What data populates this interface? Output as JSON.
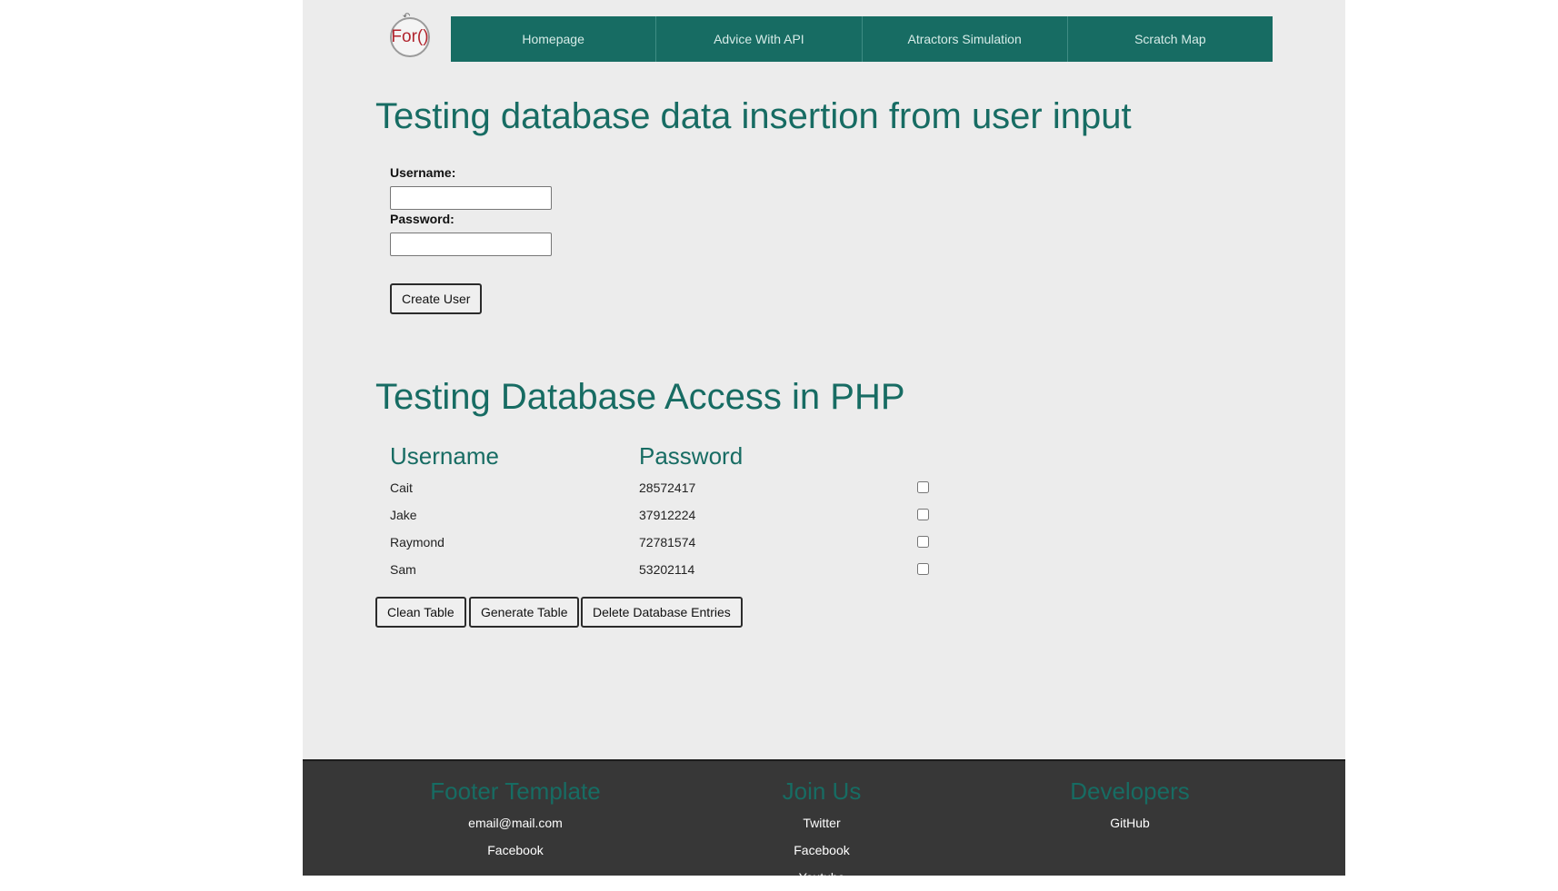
{
  "header": {
    "logo_text": "For()",
    "nav": [
      {
        "label": "Homepage"
      },
      {
        "label": "Advice With API"
      },
      {
        "label": "Atractors Simulation"
      },
      {
        "label": "Scratch Map"
      }
    ]
  },
  "insert_section": {
    "title": "Testing database data insertion from user input",
    "username_label": "Username:",
    "username_value": "",
    "password_label": "Password:",
    "password_value": "",
    "create_button": "Create User"
  },
  "access_section": {
    "title": "Testing Database Access in PHP",
    "columns": [
      "Username",
      "Password"
    ],
    "rows": [
      {
        "username": "Cait",
        "password": "28572417",
        "checked": false
      },
      {
        "username": "Jake",
        "password": "37912224",
        "checked": false
      },
      {
        "username": "Raymond",
        "password": "72781574",
        "checked": false
      },
      {
        "username": "Sam",
        "password": "53202114",
        "checked": false
      }
    ],
    "buttons": {
      "clean": "Clean Table",
      "generate": "Generate Table",
      "delete": "Delete Database Entries"
    }
  },
  "footer": {
    "template": {
      "title": "Footer Template",
      "links": [
        "email@mail.com",
        "Facebook"
      ]
    },
    "join": {
      "title": "Join Us",
      "links": [
        "Twitter",
        "Facebook",
        "Youtube"
      ]
    },
    "developers": {
      "title": "Developers",
      "links": [
        "GitHub"
      ]
    }
  },
  "colors": {
    "accent": "#176c63",
    "logo_red": "#b1252e",
    "footer_bg": "#373737",
    "page_bg": "#ececec"
  }
}
